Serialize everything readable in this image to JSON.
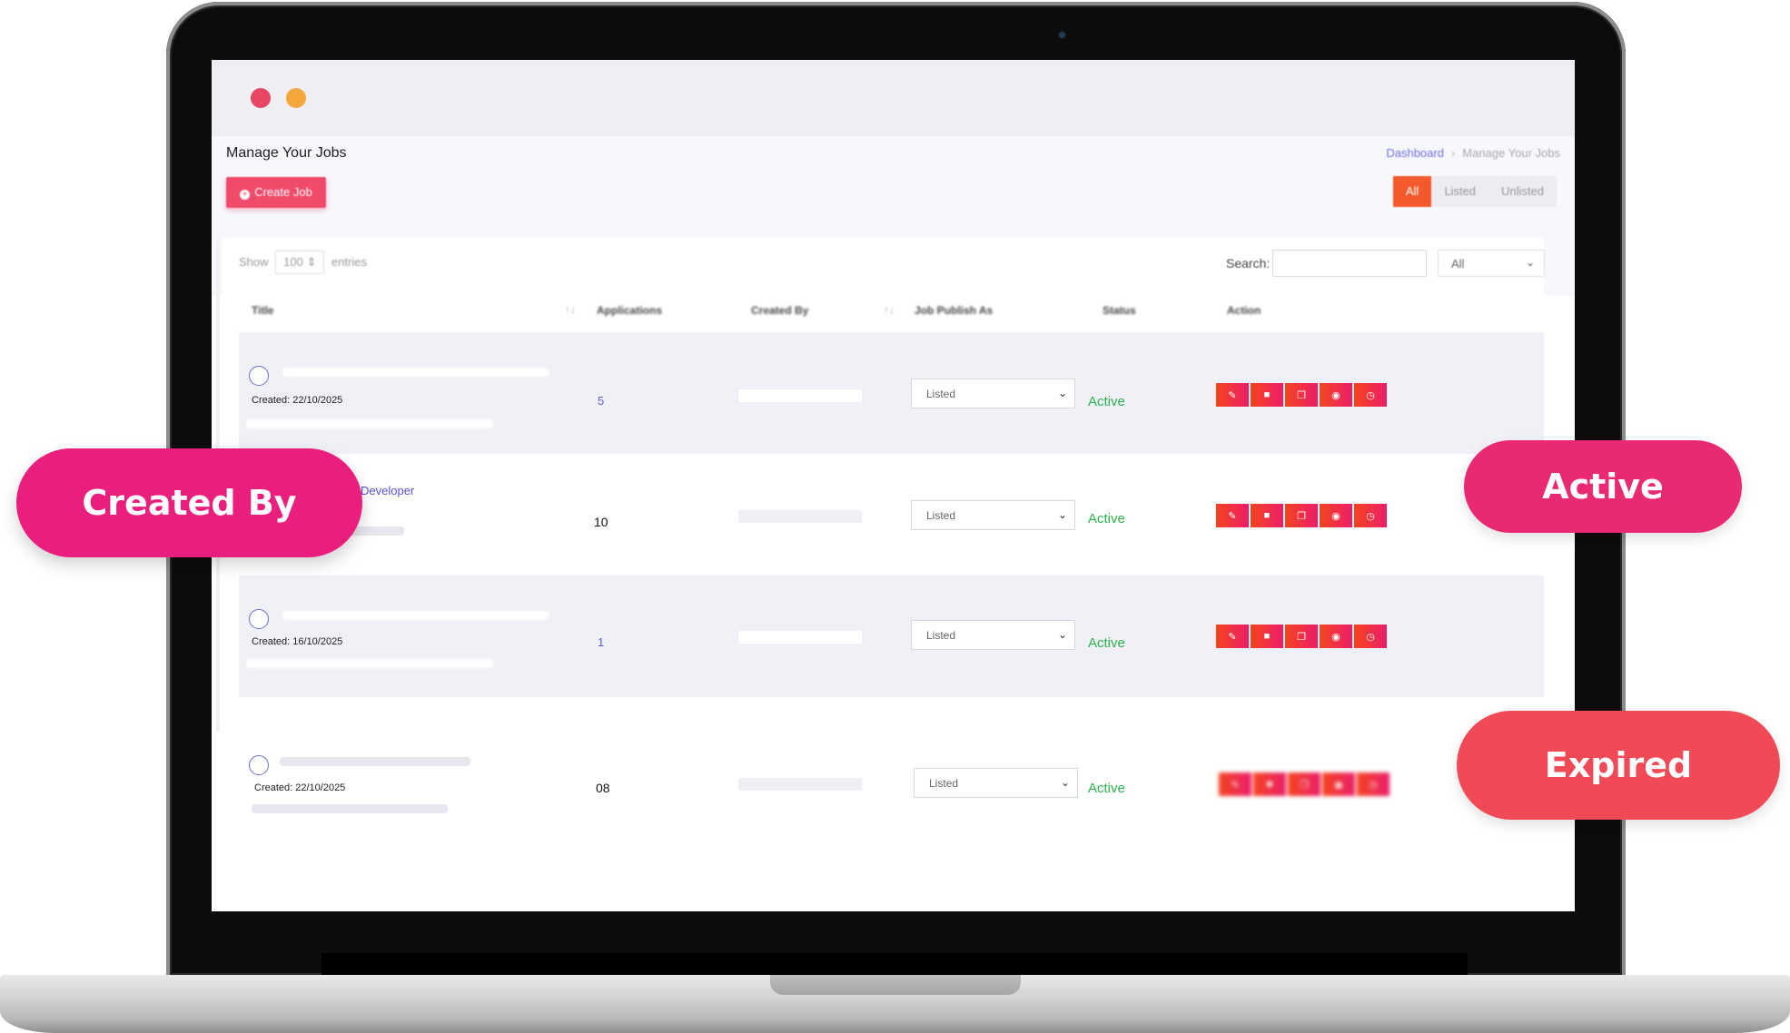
{
  "window": {
    "traffic_lights": [
      "close",
      "minimize"
    ]
  },
  "page": {
    "title": "Manage Your Jobs",
    "create_button": "Create Job",
    "breadcrumb": {
      "link": "Dashboard",
      "separator": "›",
      "current": "Manage Your Jobs"
    },
    "filter_tabs": [
      "All",
      "Listed",
      "Unlisted"
    ],
    "active_filter": "All"
  },
  "table_controls": {
    "show_label": "Show",
    "entries_value": "100",
    "entries_label": "entries",
    "search_label": "Search:",
    "search_value": "",
    "filter_value": "All"
  },
  "columns": [
    "Title",
    "Applications",
    "Created By",
    "Job Publish As",
    "Status",
    "Action"
  ],
  "rows": [
    {
      "created": "Created: 22/10/2025",
      "applications": "5",
      "publish_as": "Listed",
      "status": "Active"
    },
    {
      "title_link": "Developer",
      "applications": "10",
      "publish_as": "Listed",
      "status": "Active"
    },
    {
      "created": "Created: 16/10/2025",
      "applications": "1",
      "publish_as": "Listed",
      "status": "Active"
    },
    {
      "created": "Created: 22/10/2025",
      "applications": "08",
      "publish_as": "Listed",
      "status": "Active"
    }
  ],
  "action_icons": [
    "edit-icon",
    "trash-icon",
    "copy-icon",
    "eye-icon",
    "clock-icon"
  ],
  "callouts": {
    "created_by": "Created By",
    "active": "Active",
    "expired": "Expired"
  },
  "colors": {
    "accent": "#f04b6b",
    "status_active": "#2bb24c",
    "callout_pink": "#e91e7d",
    "callout_red": "#ef4a56"
  }
}
